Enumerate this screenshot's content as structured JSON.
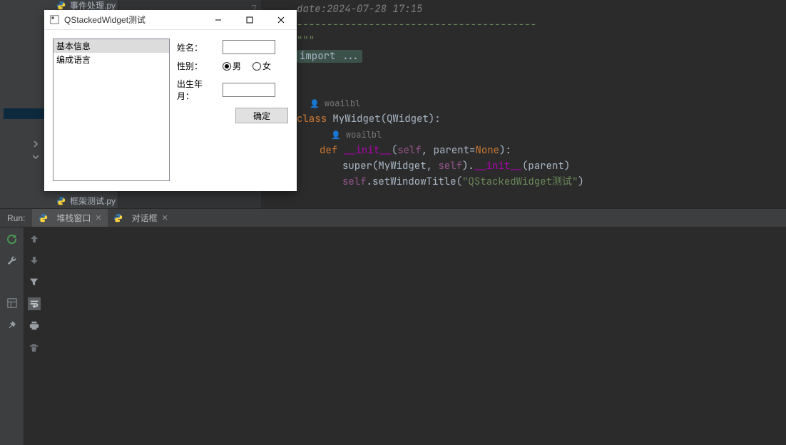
{
  "sidebar": {
    "top_file": "事件处理.py",
    "bottom_file": "框架测试.py"
  },
  "editor": {
    "gutter_num": "7",
    "lines": {
      "date_comment": "date:2024-07-28 17:15",
      "dashes": "----------------------------------------",
      "triple_quote": "\"\"\"",
      "import_fold": "import ...",
      "author": "woailbl",
      "class_kw": "class",
      "class_name": "MyWidget",
      "class_base": "(QWidget):",
      "def_kw": "def",
      "init_name": "__init__",
      "init_sig_self": "self",
      "init_sig_parent": "parent",
      "init_sig_none": "None",
      "super_call_pre": "super",
      "super_call_args": "(MyWidget, ",
      "super_self": "self",
      "super_tail": ").",
      "super_init": "__init__",
      "super_parent": "(parent)",
      "setwin_pre": "self",
      "setwin_method": ".setWindowTitle(",
      "setwin_str": "\"QStackedWidget测试\"",
      "setwin_close": ")"
    }
  },
  "run_panel": {
    "label": "Run:",
    "tabs": [
      {
        "icon": "py",
        "label": "堆栈窗口"
      },
      {
        "icon": "py",
        "label": "对话框"
      }
    ]
  },
  "dialog": {
    "title": "QStackedWidget测试",
    "list": [
      "基本信息",
      "编成语言"
    ],
    "form": {
      "name_label": "姓名：",
      "gender_label": "性别：",
      "gender_m": "男",
      "gender_f": "女",
      "birth_label": "出生年月：",
      "submit": "确定"
    }
  }
}
